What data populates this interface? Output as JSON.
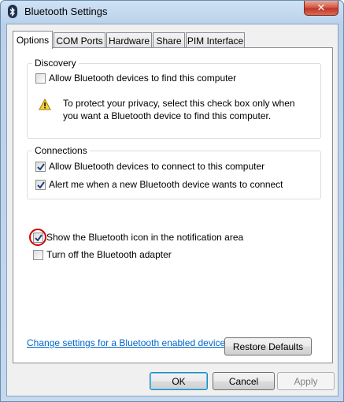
{
  "window": {
    "title": "Bluetooth Settings",
    "title_icon": "bluetooth-icon",
    "close_glyph": "✕"
  },
  "tabs": [
    {
      "label": "Options",
      "active": true
    },
    {
      "label": "COM Ports",
      "active": false
    },
    {
      "label": "Hardware",
      "active": false
    },
    {
      "label": "Share",
      "active": false
    },
    {
      "label": "PIM Interface",
      "active": false
    }
  ],
  "discovery": {
    "label": "Discovery",
    "allow_find": {
      "label": "Allow Bluetooth devices to find this computer",
      "checked": false
    },
    "warning_icon": "warning-icon",
    "note_line1": "To protect your privacy, select this check box only when",
    "note_line2": "you want a Bluetooth device to find this computer."
  },
  "connections": {
    "label": "Connections",
    "allow_connect": {
      "label": "Allow Bluetooth devices to connect to this computer",
      "checked": true
    },
    "alert_new": {
      "label": "Alert me when a new Bluetooth device wants to connect",
      "checked": true
    }
  },
  "show_icon": {
    "label": "Show the Bluetooth icon in the notification area",
    "checked": true,
    "highlighted": true
  },
  "turn_off": {
    "label": "Turn off the Bluetooth adapter",
    "checked": false
  },
  "link_text": "Change settings for a Bluetooth enabled device.",
  "buttons": {
    "restore": "Restore Defaults",
    "ok": "OK",
    "cancel": "Cancel",
    "apply": "Apply"
  },
  "colors": {
    "link": "#0066cc",
    "highlight_ring": "#d00000",
    "close_button": "#c2352b"
  }
}
